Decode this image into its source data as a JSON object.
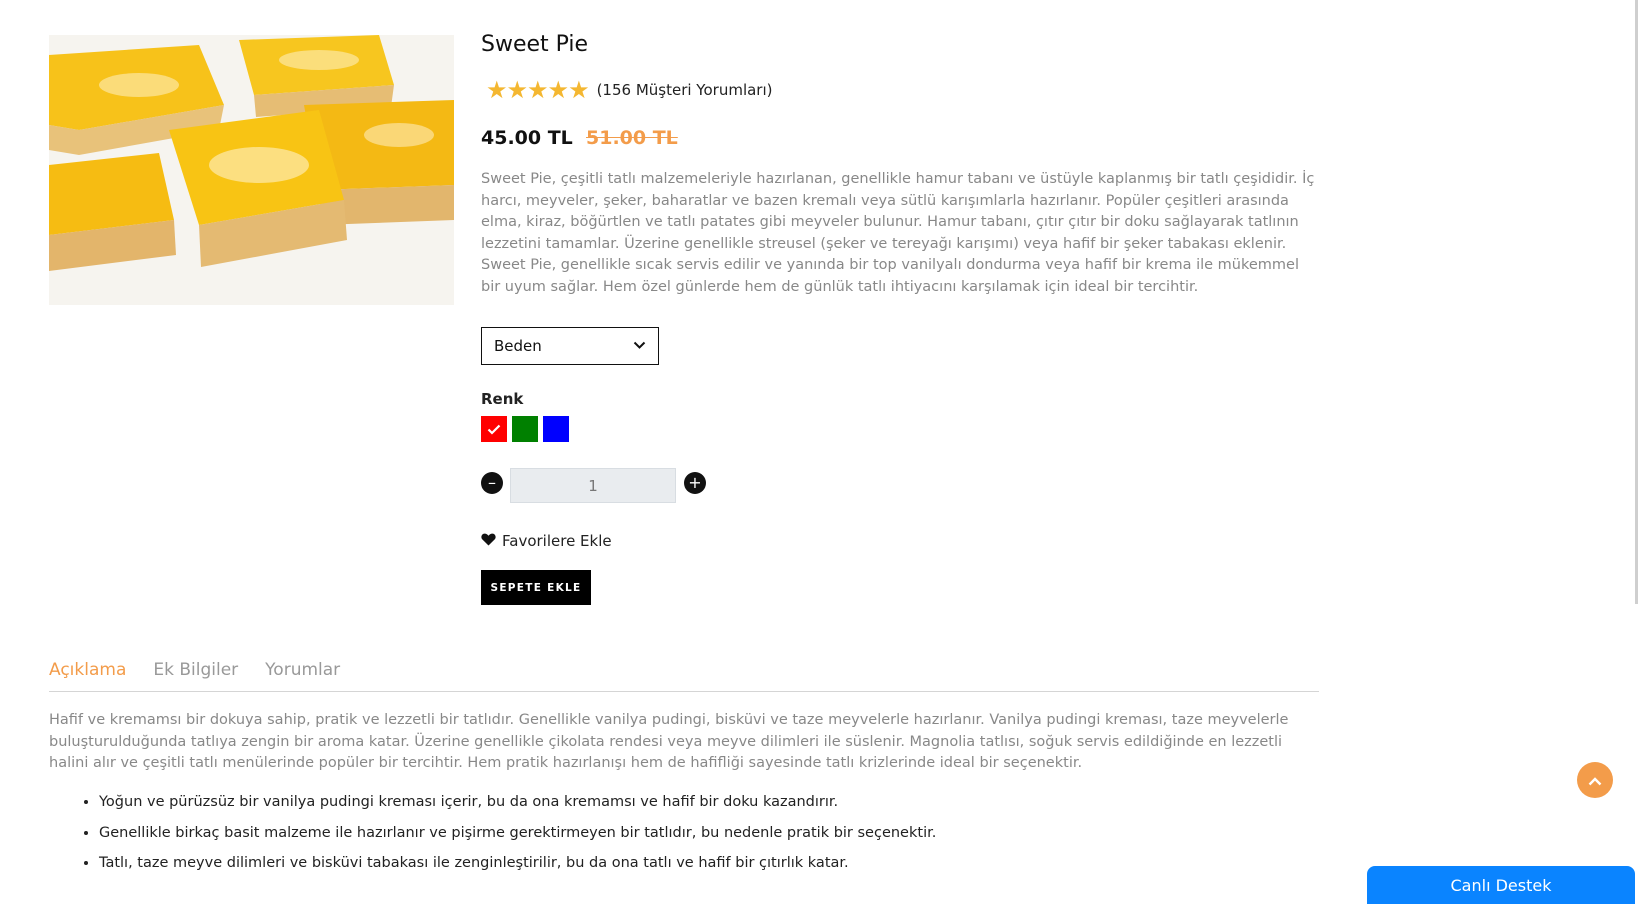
{
  "product": {
    "title": "Sweet Pie",
    "rating_stars": 5,
    "review_count_text": "(156 Müşteri Yorumları)",
    "price": "45.00 TL",
    "old_price": "51.00 TL",
    "description": "Sweet Pie, çeşitli tatlı malzemeleriyle hazırlanan, genellikle hamur tabanı ve üstüyle kaplanmış bir tatlı çeşididir. İç harcı, meyveler, şeker, baharatlar ve bazen kremalı veya sütlü karışımlarla hazırlanır. Popüler çeşitleri arasında elma, kiraz, böğürtlen ve tatlı patates gibi meyveler bulunur. Hamur tabanı, çıtır çıtır bir doku sağlayarak tatlının lezzetini tamamlar. Üzerine genellikle streusel (şeker ve tereyağı karışımı) veya hafif bir şeker tabakası eklenir. Sweet Pie, genellikle sıcak servis edilir ve yanında bir top vanilyalı dondurma veya hafif bir krema ile mükemmel bir uyum sağlar. Hem özel günlerde hem de günlük tatlı ihtiyacını karşılamak için ideal bir tercihtir."
  },
  "size_select": {
    "selected": "Beden"
  },
  "color": {
    "label": "Renk",
    "swatches": [
      {
        "color": "#ff0000",
        "selected": true
      },
      {
        "color": "#008000",
        "selected": false
      },
      {
        "color": "#0000ff",
        "selected": false
      }
    ]
  },
  "quantity": {
    "value": "1"
  },
  "favorite_label": "Favorilere Ekle",
  "add_to_cart_label": "SEPETE EKLE",
  "tabs": [
    {
      "label": "Açıklama",
      "active": true
    },
    {
      "label": "Ek Bilgiler",
      "active": false
    },
    {
      "label": "Yorumlar",
      "active": false
    }
  ],
  "tab_content": {
    "text": "Hafif ve kremamsı bir dokuya sahip, pratik ve lezzetli bir tatlıdır. Genellikle vanilya pudingi, bisküvi ve taze meyvelerle hazırlanır. Vanilya pudingi kreması, taze meyvelerle buluşturulduğunda tatlıya zengin bir aroma katar. Üzerine genellikle çikolata rendesi veya meyve dilimleri ile süslenir. Magnolia tatlısı, soğuk servis edildiğinde en lezzetli halini alır ve çeşitli tatlı menülerinde popüler bir tercihtir. Hem pratik hazırlanışı hem de hafifliği sayesinde tatlı krizlerinde ideal bir seçenektir.",
    "bullets": [
      "Yoğun ve pürüzsüz bir vanilya pudingi kreması içerir, bu da ona kremamsı ve hafif bir doku kazandırır.",
      "Genellikle birkaç basit malzeme ile hazırlanır ve pişirme gerektirmeyen bir tatlıdır, bu nedenle pratik bir seçenektir.",
      "Tatlı, taze meyve dilimleri ve bisküvi tabakası ile zenginleştirilir, bu da ona tatlı ve hafif bir çıtırlık katar."
    ]
  },
  "live_support_label": "Canlı Destek",
  "icons": {
    "star": "star-icon",
    "chevron": "chevron-down-icon",
    "heart": "heart-icon",
    "check": "check-icon",
    "scroll_top": "chevron-up-icon"
  },
  "colors": {
    "accent": "#f39c4a",
    "support_blue": "#0a84ff",
    "star": "#f4b731"
  }
}
